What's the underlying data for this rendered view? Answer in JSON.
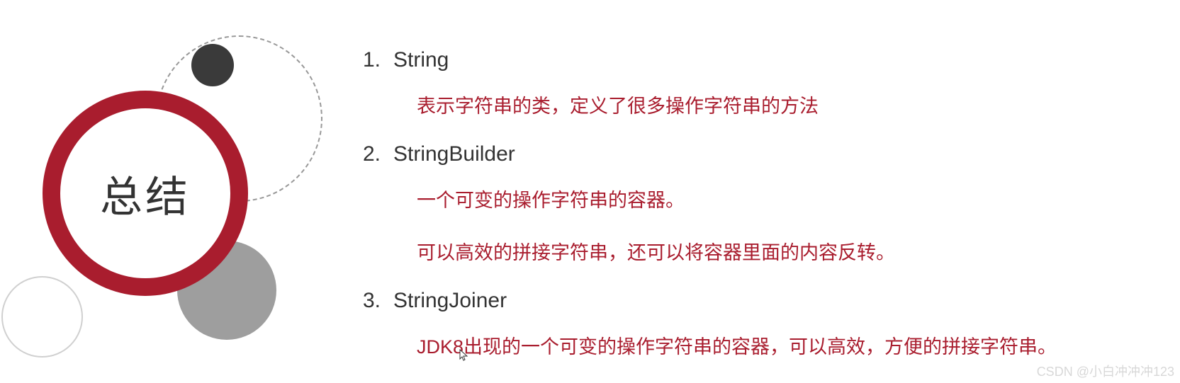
{
  "summary": {
    "title": "总结"
  },
  "items": [
    {
      "number": "1.",
      "title": "String",
      "desc": [
        "表示字符串的类，定义了很多操作字符串的方法"
      ]
    },
    {
      "number": "2.",
      "title": "StringBuilder",
      "desc": [
        "一个可变的操作字符串的容器。",
        "可以高效的拼接字符串，还可以将容器里面的内容反转。"
      ]
    },
    {
      "number": "3.",
      "title": "StringJoiner",
      "desc": [
        "JDK8出现的一个可变的操作字符串的容器，可以高效，方便的拼接字符串。"
      ]
    }
  ],
  "watermark": "CSDN @小白冲冲冲123"
}
